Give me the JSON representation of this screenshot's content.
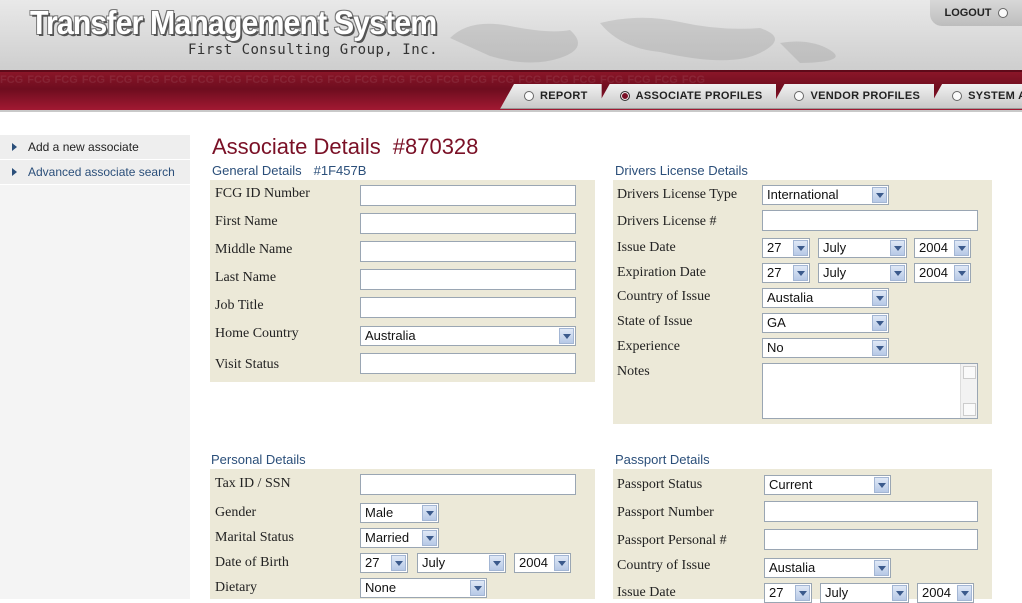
{
  "header": {
    "app_title": "Transfer Management System",
    "app_subtitle": "First Consulting Group, Inc.",
    "logout_label": "LOGOUT"
  },
  "nav": {
    "tabs": [
      {
        "label": "REPORT",
        "active": false
      },
      {
        "label": "ASSOCIATE PROFILES",
        "active": true
      },
      {
        "label": "VENDOR PROFILES",
        "active": false
      },
      {
        "label": "SYSTEM ADMIN",
        "active": false
      }
    ]
  },
  "sidebar": {
    "items": [
      {
        "label": "Add a new associate"
      },
      {
        "label": "Advanced associate search"
      }
    ]
  },
  "page": {
    "title": "Associate Details",
    "record_id": "#870328"
  },
  "general": {
    "heading": "General Details",
    "code": "#1F457B",
    "fcg_id_label": "FCG ID Number",
    "fcg_id_value": "",
    "first_name_label": "First Name",
    "first_name_value": "",
    "middle_name_label": "Middle Name",
    "middle_name_value": "",
    "last_name_label": "Last Name",
    "last_name_value": "",
    "job_title_label": "Job Title",
    "job_title_value": "",
    "home_country_label": "Home Country",
    "home_country_value": "Australia",
    "visit_status_label": "Visit Status",
    "visit_status_value": ""
  },
  "license": {
    "heading": "Drivers License Details",
    "type_label": "Drivers License Type",
    "type_value": "International",
    "number_label": "Drivers License #",
    "number_value": "",
    "issue_label": "Issue Date",
    "issue_day": "27",
    "issue_month": "July",
    "issue_year": "2004",
    "expiry_label": "Expiration Date",
    "expiry_day": "27",
    "expiry_month": "July",
    "expiry_year": "2004",
    "country_label": "Country of Issue",
    "country_value": "Austalia",
    "state_label": "State of Issue",
    "state_value": "GA",
    "experience_label": "Experience",
    "experience_value": "No",
    "notes_label": "Notes",
    "notes_value": ""
  },
  "personal": {
    "heading": "Personal Details",
    "tax_label": "Tax ID / SSN",
    "tax_value": "",
    "gender_label": "Gender",
    "gender_value": "Male",
    "marital_label": "Marital Status",
    "marital_value": "Married",
    "dob_label": "Date of Birth",
    "dob_day": "27",
    "dob_month": "July",
    "dob_year": "2004",
    "dietary_label": "Dietary",
    "dietary_value": "None"
  },
  "passport": {
    "heading": "Passport Details",
    "status_label": "Passport Status",
    "status_value": "Current",
    "number_label": "Passport Number",
    "number_value": "",
    "personal_label": "Passport Personal #",
    "personal_value": "",
    "country_label": "Country of Issue",
    "country_value": "Austalia",
    "issue_label": "Issue Date",
    "issue_day": "27",
    "issue_month": "July",
    "issue_year": "2004"
  }
}
